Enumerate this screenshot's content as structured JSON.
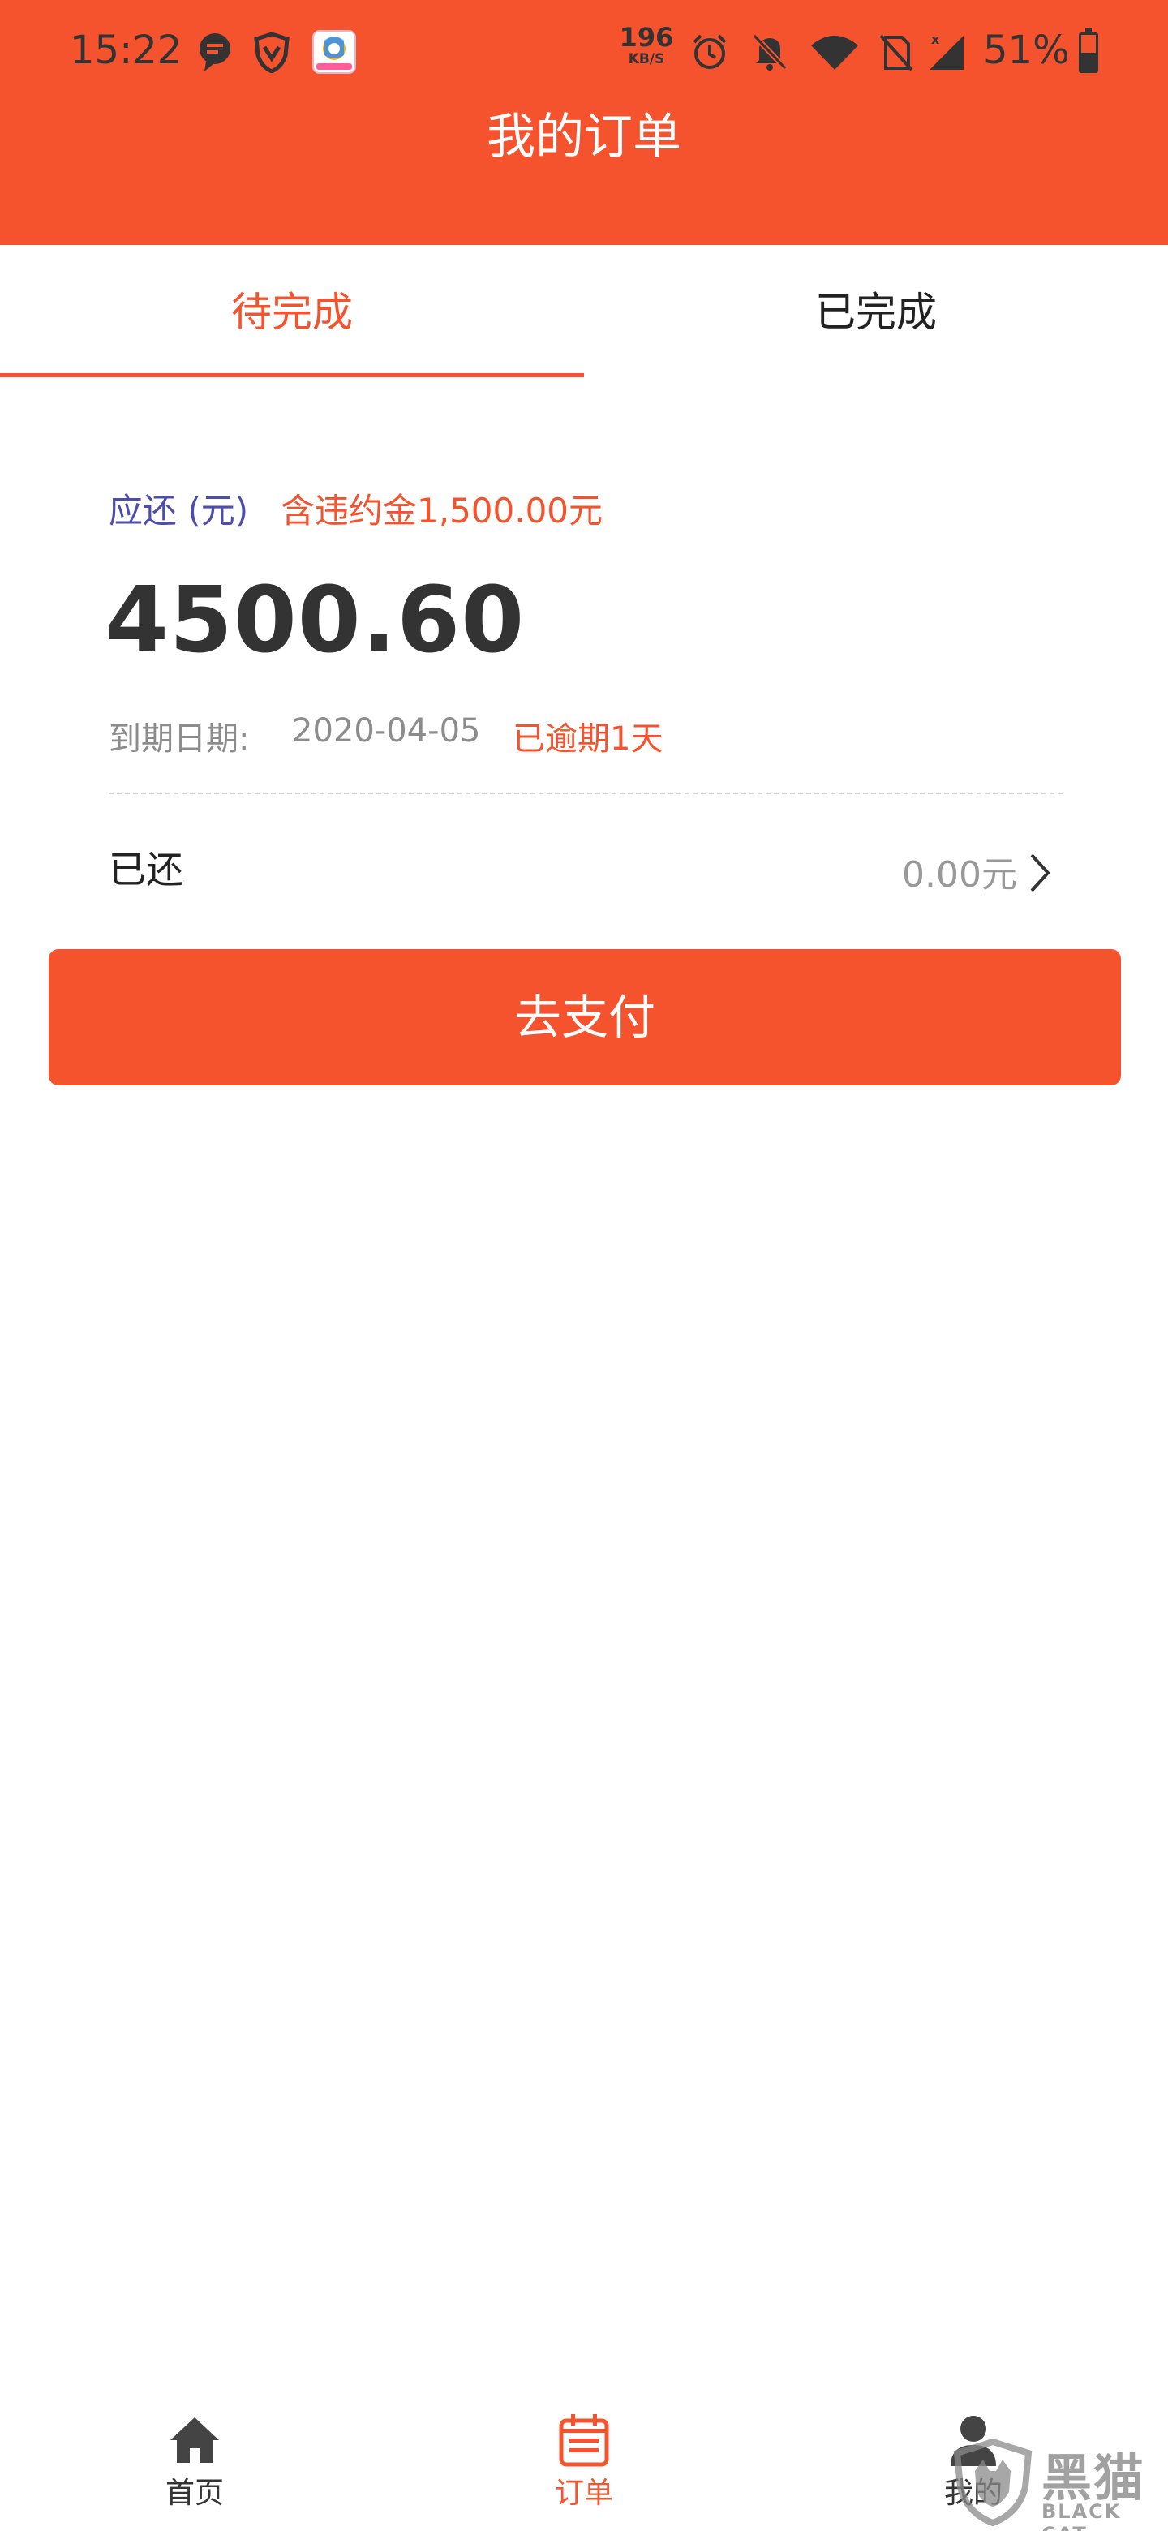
{
  "status_bar": {
    "time": "15:22",
    "net_speed_value": "196",
    "net_speed_unit": "KB/S",
    "battery_percent": "51%",
    "battery_level": 0.51,
    "icons": [
      "message-icon",
      "shield-icon",
      "app-notification-icon",
      "alarm-icon",
      "bell-off-icon",
      "wifi-icon",
      "no-sim-icon",
      "signal-icon",
      "battery-icon"
    ]
  },
  "header": {
    "title": "我的订单"
  },
  "tabs": [
    {
      "label": "待完成",
      "active": true
    },
    {
      "label": "已完成",
      "active": false
    }
  ],
  "order": {
    "due_label": "应还 (元)",
    "penalty_note": "含违约金1,500.00元",
    "amount": "4500.60",
    "due_date_label": "到期日期:",
    "due_date": "2020-04-05",
    "overdue_text": "已逾期1天",
    "paid_label": "已还",
    "paid_value": "0.00元",
    "pay_button": "去支付"
  },
  "bottom_nav": [
    {
      "label": "首页",
      "icon": "home-icon",
      "active": false
    },
    {
      "label": "订单",
      "icon": "calendar-icon",
      "active": true
    },
    {
      "label": "我的",
      "icon": "user-icon",
      "active": false
    }
  ],
  "watermark": {
    "text": "黑猫",
    "sub": "BLACK CAT"
  },
  "colors": {
    "accent": "#f5532d",
    "due_label": "#4d4dab",
    "muted": "#8c8c8c"
  }
}
